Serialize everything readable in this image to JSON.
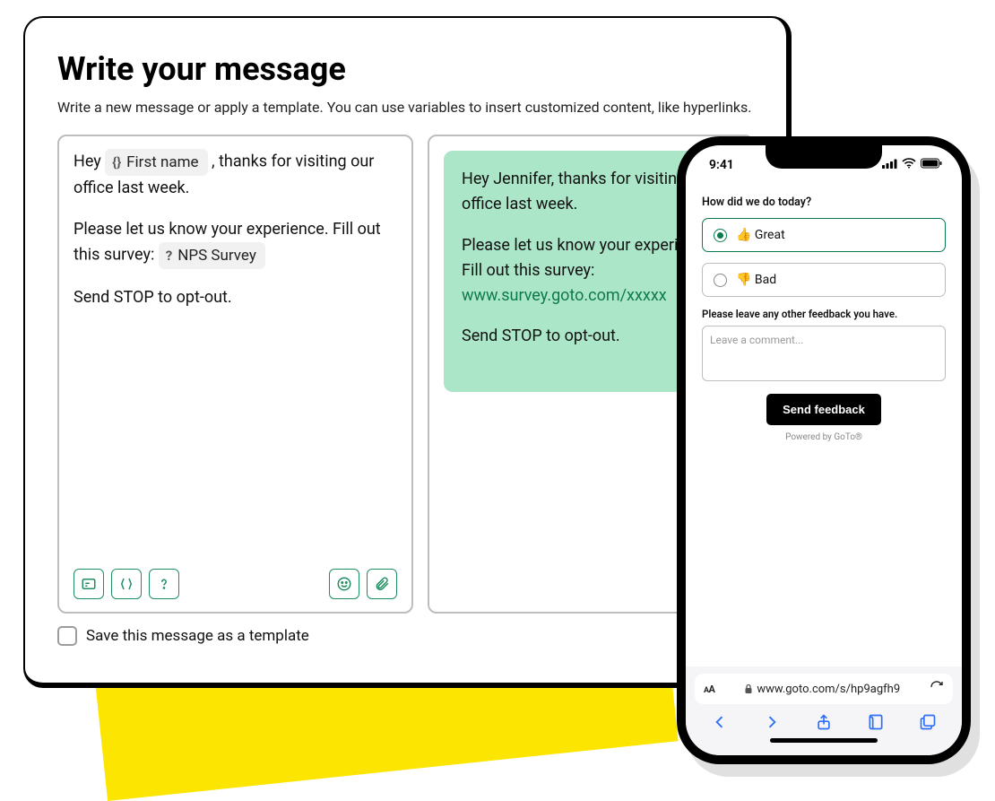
{
  "card": {
    "title": "Write your message",
    "description": "Write a new message or apply a template. You can use variables to insert customized content, like hyperlinks."
  },
  "editor": {
    "line1_pre": "Hey ",
    "chip1_icon": "{}",
    "chip1_label": "First name",
    "line1_post": ", thanks for visiting our office last week.",
    "line2_pre": "Please let us know your experience. Fill out this survey: ",
    "chip2_icon": "?",
    "chip2_label": "NPS Survey",
    "line3": "Send STOP to opt-out."
  },
  "preview": {
    "p1": "Hey Jennifer, thanks for visiting our office last week.",
    "p2_pre": "Please let us know your experience. Fill out this survey: ",
    "p2_link": "www.survey.goto.com/xxxxx",
    "p3": "Send STOP to opt-out."
  },
  "save_checkbox_label": "Save this message as a template",
  "phone": {
    "time": "9:41",
    "question": "How did we do today?",
    "option_great": "👍 Great",
    "option_bad": "👎 Bad",
    "feedback_label": "Please leave any other feedback you have.",
    "comment_placeholder": "Leave a comment...",
    "send_button": "Send feedback",
    "powered": "Powered by GoTo®",
    "url_aa": "AA",
    "url": "www.goto.com/s/hp9agfh9"
  }
}
